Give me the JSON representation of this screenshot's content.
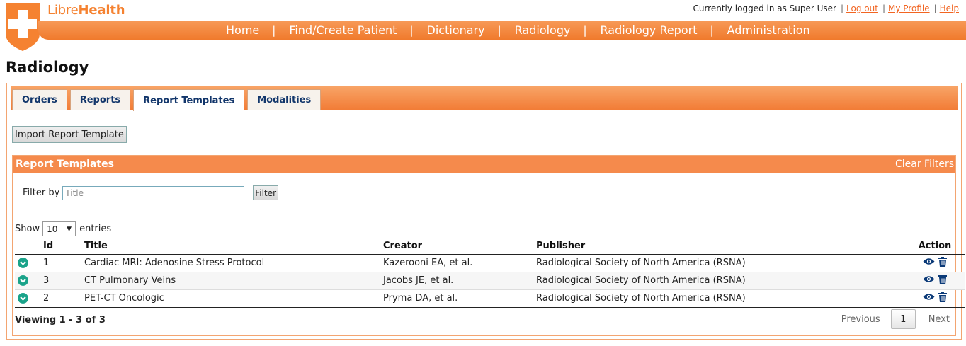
{
  "brand": {
    "libre": "Libre",
    "health": "Health"
  },
  "user_bar": {
    "logged_in_text": "Currently logged in as Super User",
    "logout": "Log out",
    "my_profile": "My Profile",
    "help": "Help"
  },
  "nav": [
    "Home",
    "Find/Create Patient",
    "Dictionary",
    "Radiology",
    "Radiology Report",
    "Administration"
  ],
  "page_title": "Radiology",
  "tabs": [
    "Orders",
    "Reports",
    "Report Templates",
    "Modalities"
  ],
  "active_tab": "Report Templates",
  "import_button": "Import Report Template",
  "section": {
    "title": "Report Templates",
    "clear_filters": "Clear Filters"
  },
  "filter": {
    "label": "Filter by",
    "placeholder": "Title",
    "button": "Filter"
  },
  "length": {
    "show": "Show",
    "value": "10",
    "entries": "entries"
  },
  "table": {
    "headers": {
      "id": "Id",
      "title": "Title",
      "creator": "Creator",
      "publisher": "Publisher",
      "action": "Action"
    },
    "rows": [
      {
        "id": "1",
        "title": "Cardiac MRI: Adenosine Stress Protocol",
        "creator": "Kazerooni EA, et al.",
        "publisher": "Radiological Society of North America (RSNA)"
      },
      {
        "id": "3",
        "title": "CT Pulmonary Veins",
        "creator": "Jacobs JE, et al.",
        "publisher": "Radiological Society of North America (RSNA)"
      },
      {
        "id": "2",
        "title": "PET-CT Oncologic",
        "creator": "Pryma DA, et al.",
        "publisher": "Radiological Society of North America (RSNA)"
      }
    ]
  },
  "info": "Viewing 1 - 3 of 3",
  "pager": {
    "previous": "Previous",
    "page": "1",
    "next": "Next"
  },
  "colors": {
    "accent": "#f58231",
    "teal": "#1aa38a",
    "navy_icon": "#0b3a78",
    "tab_text": "#12366b"
  },
  "icons": {
    "expand": "chevron-down-circle-icon",
    "view": "eye-icon",
    "delete": "trash-icon",
    "logo": "plus-shield-icon"
  }
}
